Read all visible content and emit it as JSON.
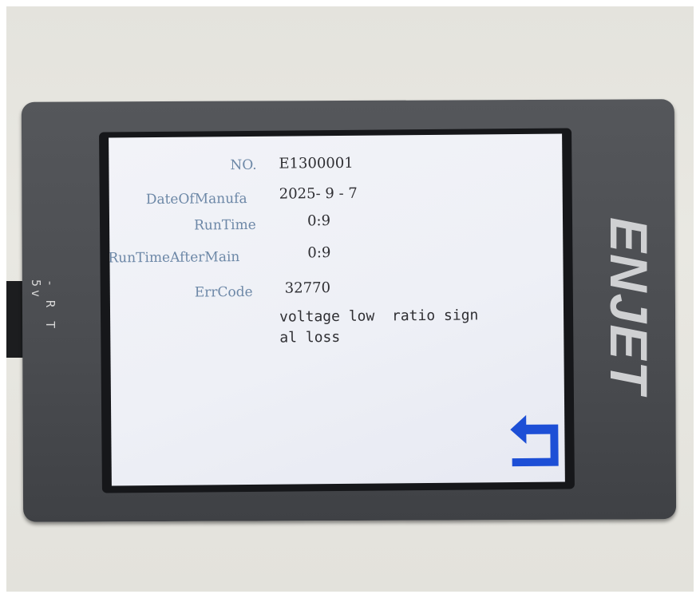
{
  "device": {
    "brand": "ENJET",
    "port_label": "- R T 5v"
  },
  "screen": {
    "fields": [
      {
        "label": "NO.",
        "value": "E1300001"
      },
      {
        "label": "DateOfManufa",
        "value": "2025- 9 - 7"
      },
      {
        "label": "RunTime",
        "value": "0:9"
      },
      {
        "label": "RunTimeAfterMain",
        "value": "0:9"
      },
      {
        "label": "ErrCode",
        "value": "32770"
      }
    ],
    "error_message": "voltage low  ratio sign\nal loss",
    "back_icon": "return-arrow-icon"
  },
  "colors": {
    "label_color": "#6d88a7",
    "value_color": "#2f2f33",
    "accent_blue": "#1d4fd6",
    "screen_bg": "#f0f1f7",
    "device_body": "#4d4f53"
  }
}
